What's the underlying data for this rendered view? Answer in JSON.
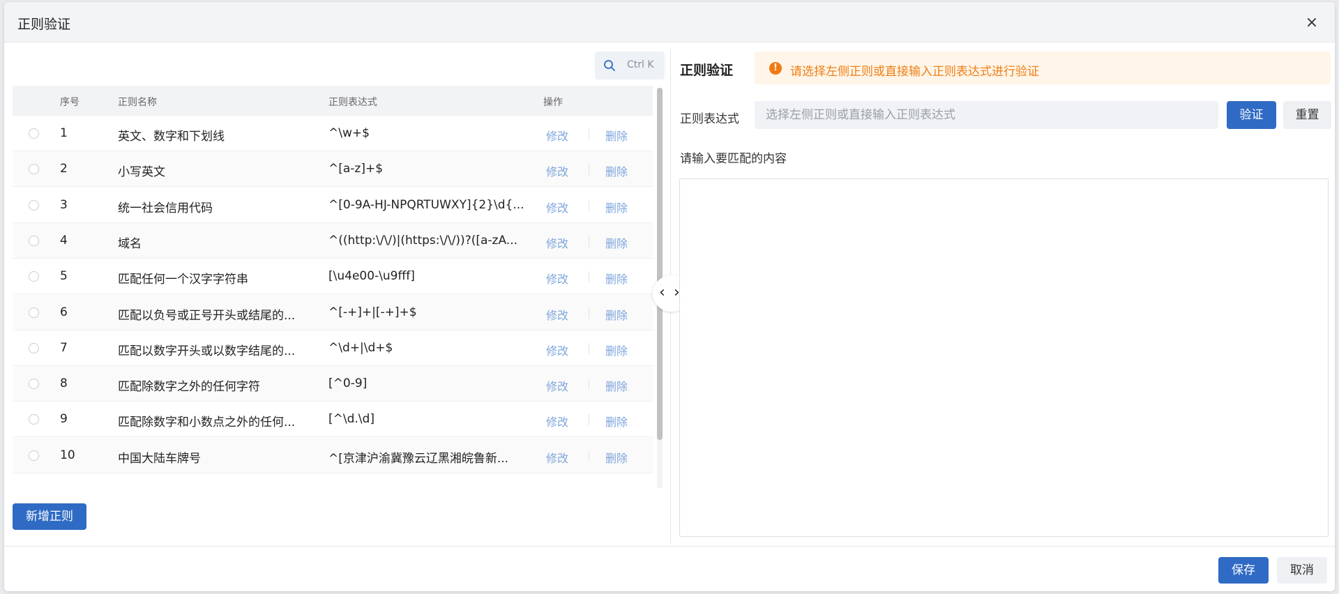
{
  "dialog": {
    "title": "正则验证",
    "close_icon": "close-icon"
  },
  "search": {
    "shortcut": "Ctrl K",
    "icon": "search-icon"
  },
  "table": {
    "headers": {
      "index": "序号",
      "name": "正则名称",
      "expr": "正则表达式",
      "actions": "操作"
    },
    "edit_label": "修改",
    "delete_label": "删除",
    "rows": [
      {
        "index": "1",
        "name": "英文、数字和下划线",
        "expr": "^\\w+$"
      },
      {
        "index": "2",
        "name": "小写英文",
        "expr": "^[a-z]+$"
      },
      {
        "index": "3",
        "name": "统一社会信用代码",
        "expr": "^[0-9A-HJ-NPQRTUWXY]{2}\\d{..."
      },
      {
        "index": "4",
        "name": "域名",
        "expr": "^((http:\\/\\/)|(https:\\/\\/))?([a-zA..."
      },
      {
        "index": "5",
        "name": "匹配任何一个汉字字符串",
        "expr": "[\\u4e00-\\u9fff]"
      },
      {
        "index": "6",
        "name": "匹配以负号或正号开头或结尾的...",
        "expr": "^[-+]+|[-+]+$"
      },
      {
        "index": "7",
        "name": "匹配以数字开头或以数字结尾的...",
        "expr": "^\\d+|\\d+$"
      },
      {
        "index": "8",
        "name": "匹配除数字之外的任何字符",
        "expr": "[^0-9]"
      },
      {
        "index": "9",
        "name": "匹配除数字和小数点之外的任何...",
        "expr": "[^\\d.\\d]"
      },
      {
        "index": "10",
        "name": "中国大陆车牌号",
        "expr": "^[京津沪渝冀豫云辽黑湘皖鲁新..."
      }
    ]
  },
  "add_button": "新增正则",
  "panel_toggle": {
    "left_icon": "chevron-left-icon",
    "right_icon": "chevron-right-icon"
  },
  "validator": {
    "title": "正则验证",
    "alert": "请选择左侧正则或直接输入正则表达式进行验证",
    "alert_icon": "warning-icon",
    "alert_color": "#ef7e16",
    "expr_label": "正则表达式",
    "expr_placeholder": "选择左侧正则或直接输入正则表达式",
    "expr_value": "",
    "verify_button": "验证",
    "reset_button": "重置",
    "content_label": "请输入要匹配的内容",
    "content_value": ""
  },
  "footer": {
    "save_button": "保存",
    "cancel_button": "取消"
  },
  "colors": {
    "primary": "#2f6bc4",
    "link": "#7fa6dc"
  }
}
